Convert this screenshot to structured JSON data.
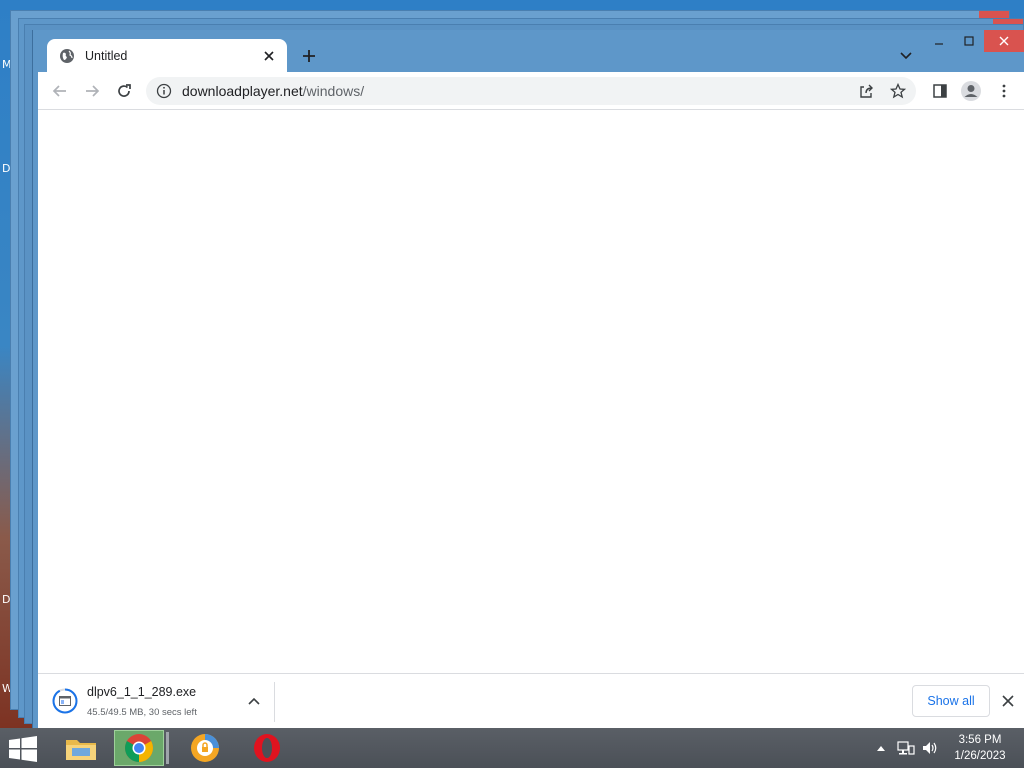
{
  "desktop": {
    "edge_labels": [
      "M",
      "D",
      "D",
      "W"
    ]
  },
  "browser": {
    "tab": {
      "title": "Untitled",
      "icon": "globe-icon"
    },
    "new_tab_icon": "plus-icon",
    "address": {
      "domain": "downloadplayer.net",
      "path": "/windows/"
    },
    "accent_color": "#5e97c9"
  },
  "download": {
    "filename": "dlpv6_1_1_289.exe",
    "status": "45.5/49.5 MB, 30 secs left",
    "show_all_label": "Show all"
  },
  "taskbar": {
    "apps": [
      "file-explorer-icon",
      "chrome-icon",
      "lock-browser-icon",
      "opera-icon"
    ],
    "clock": {
      "time": "3:56 PM",
      "date": "1/26/2023"
    }
  }
}
